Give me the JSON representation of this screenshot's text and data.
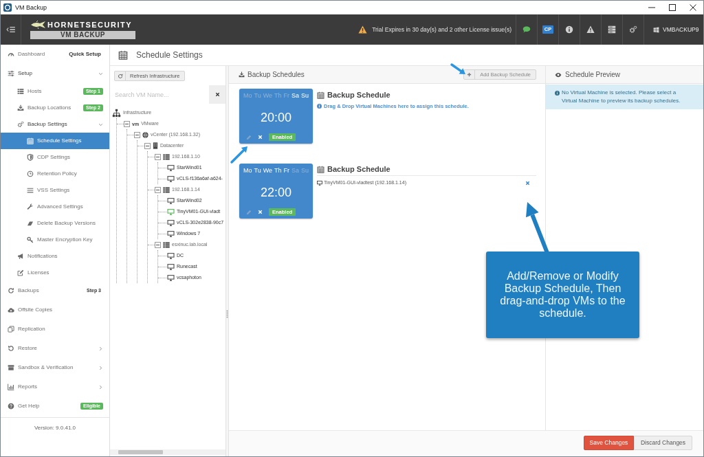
{
  "window": {
    "title": "VM Backup"
  },
  "header": {
    "logo": {
      "brand": "HORNETSECURITY",
      "product": "VM BACKUP"
    },
    "license_warning": "Trial Expires in 30 day(s) and 2 other License issue(s)",
    "cp_label": "CP",
    "machine": "VMBACKUP9"
  },
  "sidebar": {
    "items": [
      {
        "label": "Dashboard",
        "selected": false,
        "badge": {
          "text": "Quick Setup",
          "kind": "link"
        }
      },
      {
        "label": "Setup",
        "selected": false,
        "expanded": true,
        "children": [
          {
            "label": "Hosts",
            "selected": false,
            "badge": {
              "text": "Step 1",
              "kind": "pill"
            }
          },
          {
            "label": "Backup Locations",
            "selected": false,
            "badge": {
              "text": "Step 2",
              "kind": "pill"
            }
          },
          {
            "label": "Backup Settings",
            "selected": false,
            "expanded": true,
            "children": [
              {
                "label": "Schedule Settings",
                "selected": true
              },
              {
                "label": "CDP Settings",
                "selected": false
              },
              {
                "label": "Retention Policy",
                "selected": false
              },
              {
                "label": "VSS Settings",
                "selected": false
              },
              {
                "label": "Advanced Settings",
                "selected": false
              },
              {
                "label": "Delete Backup Versions",
                "selected": false
              },
              {
                "label": "Master Encryption Key",
                "selected": false
              }
            ]
          },
          {
            "label": "Notifications",
            "selected": false
          },
          {
            "label": "Licenses",
            "selected": false
          }
        ]
      },
      {
        "label": "Backups",
        "selected": false,
        "badge": {
          "text": "Step 3",
          "kind": "plain"
        }
      },
      {
        "label": "Offsite Copies",
        "selected": false
      },
      {
        "label": "Replication",
        "selected": false
      },
      {
        "label": "Restore",
        "selected": false,
        "expanded": false
      },
      {
        "label": "Sandbox & Verification",
        "selected": false,
        "expanded": false
      },
      {
        "label": "Reports",
        "selected": false,
        "expanded": false
      },
      {
        "label": "Get Help",
        "selected": false,
        "badge": {
          "text": "Eligible",
          "kind": "pill"
        }
      }
    ],
    "version": "Version: 9.0.41.0"
  },
  "page": {
    "title": "Schedule Settings"
  },
  "infrastructure": {
    "refresh_button": "Refresh Infrastructure",
    "search": {
      "placeholder": "Search VM Name..."
    },
    "tree": [
      {
        "label": "Infrastructure",
        "kind": "root",
        "children": [
          {
            "label": "VMware",
            "kind": "vendor",
            "logo_text": "vm",
            "expanded": true,
            "children": [
              {
                "label": "vCenter (192.168.1.32)",
                "kind": "vcenter",
                "expanded": true,
                "children": [
                  {
                    "label": "Datacenter",
                    "kind": "datacenter",
                    "expanded": true,
                    "children": [
                      {
                        "label": "192.168.1.10",
                        "kind": "host",
                        "expanded": true,
                        "children": [
                          {
                            "label": "StarWind01",
                            "kind": "vm",
                            "scheduled": false
                          },
                          {
                            "label": "vCLS-f136a6af-a624-",
                            "kind": "vm",
                            "scheduled": false
                          }
                        ]
                      },
                      {
                        "label": "192.168.1.14",
                        "kind": "host",
                        "expanded": true,
                        "children": [
                          {
                            "label": "StarWind02",
                            "kind": "vm",
                            "scheduled": false
                          },
                          {
                            "label": "TinyVM01-GUI-vladt",
                            "kind": "vm",
                            "scheduled": true
                          },
                          {
                            "label": "vCLS-302e2838-90c7",
                            "kind": "vm",
                            "scheduled": false
                          },
                          {
                            "label": "Windows 7",
                            "kind": "vm",
                            "scheduled": false
                          }
                        ]
                      },
                      {
                        "label": "esxinuc.lab.local",
                        "kind": "host",
                        "expanded": true,
                        "children": [
                          {
                            "label": "DC",
                            "kind": "vm",
                            "scheduled": false
                          },
                          {
                            "label": "Runecast",
                            "kind": "vm",
                            "scheduled": false
                          },
                          {
                            "label": "vcsaphoton",
                            "kind": "vm",
                            "scheduled": false
                          }
                        ]
                      }
                    ]
                  }
                ]
              }
            ]
          }
        ]
      }
    ]
  },
  "schedules_panel": {
    "title": "Backup Schedules",
    "add_button": "Add Backup Schedule",
    "schedules": [
      {
        "days": [
          {
            "label": "Mo",
            "selected": false
          },
          {
            "label": "Tu",
            "selected": false
          },
          {
            "label": "We",
            "selected": false
          },
          {
            "label": "Th",
            "selected": false
          },
          {
            "label": "Fr",
            "selected": false
          },
          {
            "label": "Sa",
            "selected": true
          },
          {
            "label": "Su",
            "selected": true
          }
        ],
        "time": "20:00",
        "status": "Enabled",
        "enabled": true,
        "title": "Backup Schedule",
        "hint": "Drag & Drop Virtual Machines here to assign this schedule."
      },
      {
        "days": [
          {
            "label": "Mo",
            "selected": true
          },
          {
            "label": "Tu",
            "selected": true
          },
          {
            "label": "We",
            "selected": true
          },
          {
            "label": "Th",
            "selected": true
          },
          {
            "label": "Fr",
            "selected": true
          },
          {
            "label": "Sa",
            "selected": false
          },
          {
            "label": "Su",
            "selected": false
          }
        ],
        "time": "22:00",
        "status": "Enabled",
        "enabled": true,
        "title": "Backup Schedule",
        "vms": [
          {
            "name": "TinyVM01-GUI-vladtest (192.168.1.14)"
          }
        ]
      }
    ]
  },
  "preview_panel": {
    "title": "Schedule Preview",
    "message": "No Virtual Machine is selected. Please select a Virtual Machine to preview its backup schedules."
  },
  "footer": {
    "buttons": [
      {
        "label": "Save Changes",
        "kind": "primary"
      },
      {
        "label": "Discard Changes",
        "kind": "default"
      }
    ]
  },
  "annotation": {
    "callout": "Add/Remove or Modify Backup Schedule, Then drag-and-drop VMs to the schedule."
  }
}
